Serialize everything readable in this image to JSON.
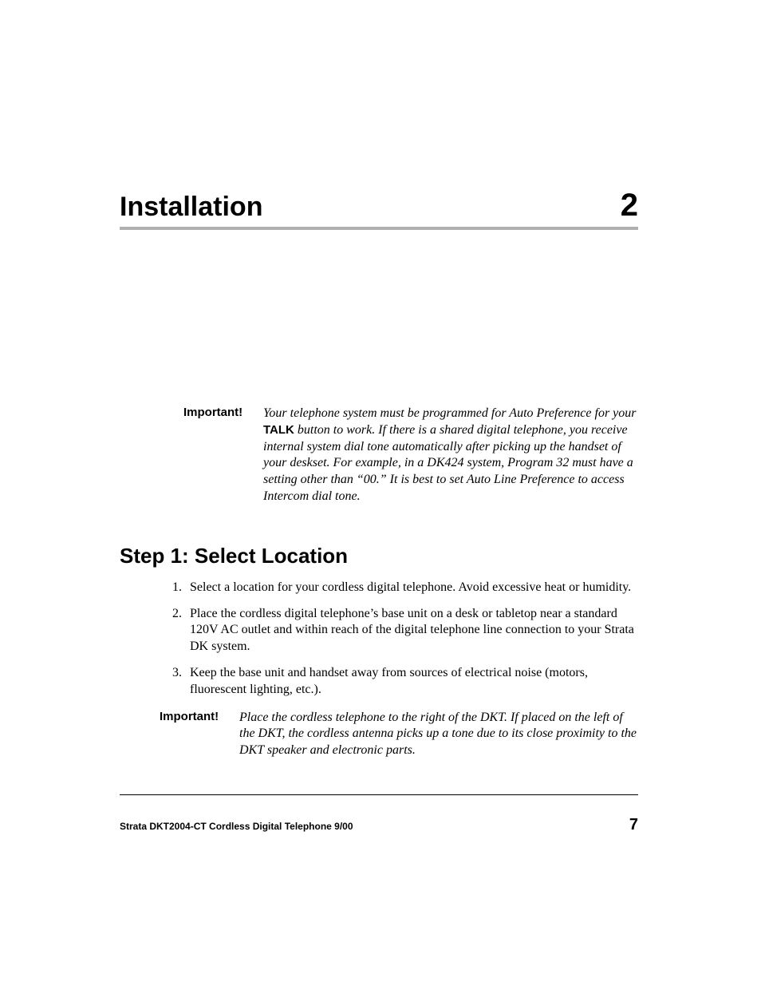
{
  "chapter": {
    "title": "Installation",
    "number": "2"
  },
  "important1": {
    "label": "Important!",
    "text_before": "Your telephone system must be programmed for Auto Preference for your ",
    "bold_word": "TALK",
    "text_after": " button to work. If there is a shared digital telephone, you receive internal system dial tone automatically after picking up the handset of your deskset. For example, in a DK424 system, Program 32 must have a setting other than “00.” It is best to set Auto Line Preference to access Intercom dial tone."
  },
  "section": {
    "heading": "Step 1:  Select Location",
    "items": [
      {
        "num": "1.",
        "text": "Select a location for your cordless digital telephone. Avoid excessive heat or humidity."
      },
      {
        "num": "2.",
        "text": "Place the cordless digital telephone’s base unit on a desk or tabletop near a standard 120V AC outlet and within reach of the digital telephone line connection to your Strata DK system."
      },
      {
        "num": "3.",
        "text": "Keep the base unit and handset away from sources of electrical noise (motors, fluorescent lighting, etc.)."
      }
    ]
  },
  "important2": {
    "label": "Important!",
    "text": "Place the cordless telephone to the right of the DKT. If placed on the left of the DKT, the cordless antenna picks up a tone due to its close proximity to the DKT speaker and electronic parts."
  },
  "footer": {
    "left": "Strata DKT2004-CT Cordless Digital Telephone   9/00",
    "right": "7"
  }
}
